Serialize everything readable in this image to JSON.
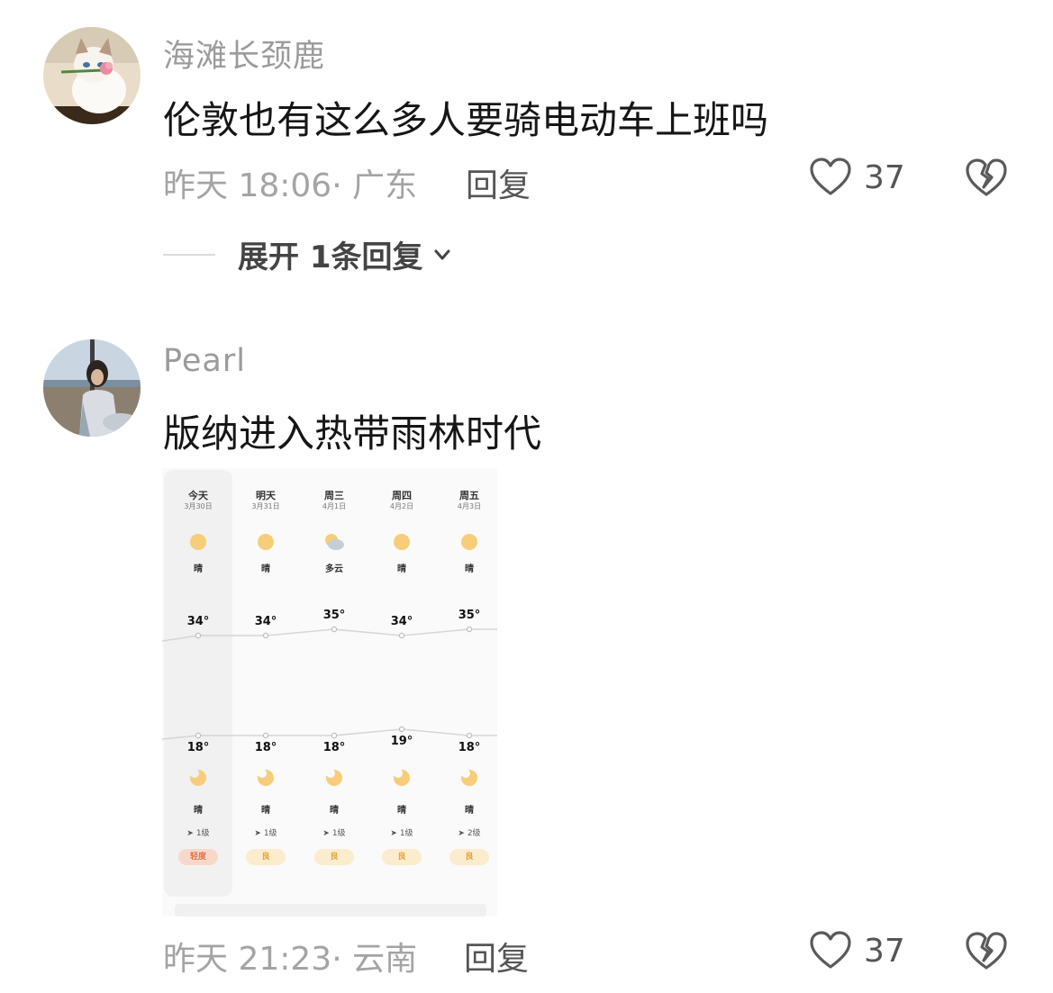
{
  "comments": [
    {
      "username": "海滩长颈鹿",
      "text": "伦敦也有这么多人要骑电动车上班吗",
      "time_location": "昨天 18:06· 广东",
      "reply_label": "回复",
      "like_count": "37",
      "expand_label": "展开 1条回复"
    },
    {
      "username": "Pearl",
      "text": "版纳进入热带雨林时代",
      "time_location": "昨天 21:23· 云南",
      "reply_label": "回复",
      "like_count": "37"
    }
  ],
  "weather": {
    "days": [
      {
        "name": "今天",
        "date": "3月30日",
        "condition": "晴",
        "high": "34°",
        "low": "18°",
        "night_condition": "晴",
        "wind": "1级",
        "aqi": "轻度",
        "aqi_color": "#f7d9cc",
        "aqi_text_color": "#e0734a"
      },
      {
        "name": "明天",
        "date": "3月31日",
        "condition": "晴",
        "high": "34°",
        "low": "18°",
        "night_condition": "晴",
        "wind": "1级",
        "aqi": "良",
        "aqi_color": "#fbeccd",
        "aqi_text_color": "#e0a53a"
      },
      {
        "name": "周三",
        "date": "4月1日",
        "condition": "多云",
        "high": "35°",
        "low": "18°",
        "night_condition": "晴",
        "wind": "1级",
        "aqi": "良",
        "aqi_color": "#fbeccd",
        "aqi_text_color": "#e0a53a"
      },
      {
        "name": "周四",
        "date": "4月2日",
        "condition": "晴",
        "high": "34°",
        "low": "19°",
        "night_condition": "晴",
        "wind": "1级",
        "aqi": "良",
        "aqi_color": "#fbeccd",
        "aqi_text_color": "#e0a53a"
      },
      {
        "name": "周五",
        "date": "4月3日",
        "condition": "晴",
        "high": "35°",
        "low": "18°",
        "night_condition": "晴",
        "wind": "2级",
        "aqi": "良",
        "aqi_color": "#fbeccd",
        "aqi_text_color": "#e0a53a"
      }
    ]
  },
  "icons": {
    "like": "heart-outline-icon",
    "dislike": "broken-heart-icon",
    "expand": "chevron-down-icon",
    "sun": "sun-icon",
    "cloudy": "partly-cloudy-icon",
    "moon": "moon-icon",
    "wind": "wind-arrow-icon"
  }
}
